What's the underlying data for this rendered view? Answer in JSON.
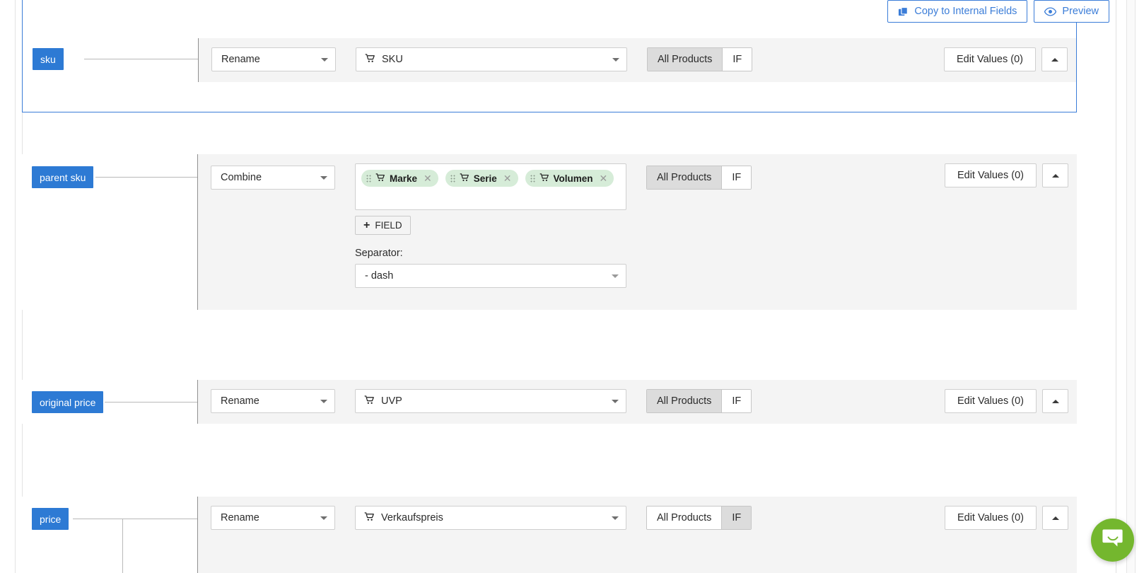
{
  "toolbar": {
    "copy_label": "Copy to Internal Fields",
    "preview_label": "Preview",
    "copy_icon": "copy-icon",
    "preview_icon": "eye-icon"
  },
  "common": {
    "edit_values_label": "Edit Values (0)",
    "collapse_icon": "chevron-up-icon",
    "seg_all_label": "All Products",
    "seg_if_label": "IF",
    "add_field_label": "FIELD",
    "separator_label": "Separator:",
    "cart_icon": "shopping-cart-icon",
    "remove_icon": "close-icon",
    "drag_icon": "drag-handle-icon"
  },
  "colors": {
    "badge": "#2d7ad4",
    "accent": "#3b7dd8",
    "chip": "#d6ecd8",
    "strip": "#f4f4f4",
    "selected_border": "#3b7dd8",
    "intercom": "#74b72e"
  },
  "rows": [
    {
      "badge": "sku",
      "operation": "Rename",
      "field": "SKU",
      "scope": "all",
      "selected": true,
      "edit_values": "Edit Values (0)"
    },
    {
      "badge": "parent sku",
      "operation": "Combine",
      "chips": [
        "Marke",
        "Serie",
        "Volumen"
      ],
      "separator": "- dash",
      "scope": "all",
      "selected": false,
      "edit_values": "Edit Values (0)"
    },
    {
      "badge": "original price",
      "operation": "Rename",
      "field": "UVP",
      "scope": "all",
      "selected": false,
      "edit_values": "Edit Values (0)"
    },
    {
      "badge": "price",
      "operation": "Rename",
      "field": "Verkaufspreis",
      "scope": "if",
      "selected": false,
      "edit_values": "Edit Values (0)"
    }
  ],
  "intercom": {
    "icon": "chat-bubble-icon"
  }
}
